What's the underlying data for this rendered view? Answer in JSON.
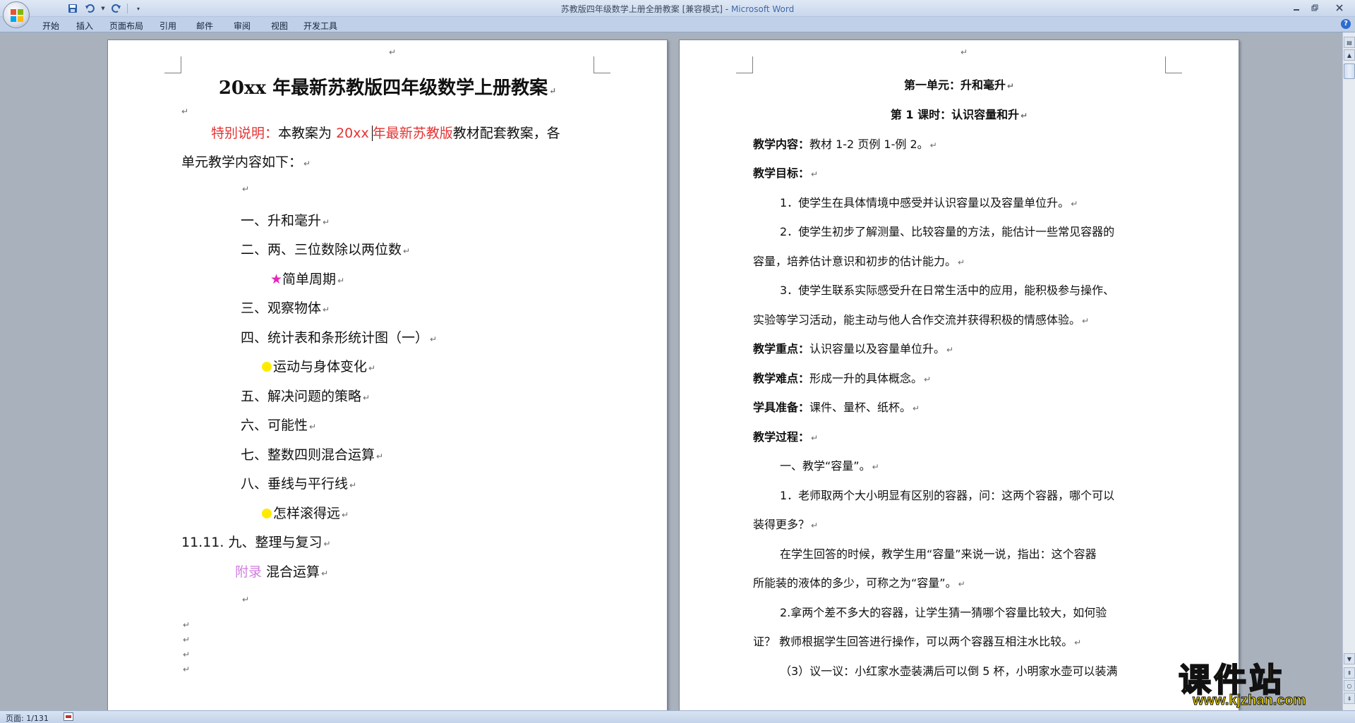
{
  "window": {
    "title": "苏教版四年级数学上册全册教案 [兼容模式]",
    "app_name": "Microsoft Word",
    "title_sep": " - "
  },
  "qat": {
    "save_icon": "save-icon",
    "undo_icon": "undo-icon",
    "redo_icon": "redo-icon",
    "customize_icon": "dropdown-icon"
  },
  "ribbon": {
    "tabs": [
      "开始",
      "插入",
      "页面布局",
      "引用",
      "邮件",
      "审阅",
      "视图",
      "开发工具"
    ]
  },
  "left_page": {
    "title": "20xx 年最新苏教版四年级数学上册教案",
    "intro_label": "特别说明：",
    "intro_text1": "本教案为 ",
    "intro_year": "20xx ",
    "intro_red": "年最新苏教版",
    "intro_text2": "教材配套教案，各",
    "intro_line2": "单元教学内容如下：",
    "units": [
      "一、升和毫升",
      "二、两、三位数除以两位数",
      "简单周期",
      "三、观察物体",
      "四、统计表和条形统计图（一）",
      "运动与身体变化",
      "五、解决问题的策略",
      "六、可能性",
      "七、整数四则混合运算",
      "八、垂线与平行线",
      "怎样滚得远",
      "11.11. 九、整理与复习"
    ],
    "appendix_label": "附录",
    "appendix_text": " 混合运算",
    "star_symbol": "★",
    "para_mark": "↵"
  },
  "right_page": {
    "unit_title": "第一单元：升和毫升",
    "lesson_title": "第 1 课时：认识容量和升",
    "content_label": "教学内容：",
    "content_text": "教材 1-2 页例 1-例 2。",
    "goals_label": "教学目标：",
    "goal1": "1．使学生在具体情境中感受并认识容量以及容量单位升。",
    "goal2a": "2．使学生初步了解测量、比较容量的方法，能估计一些常见容器的",
    "goal2b": "容量，培养估计意识和初步的估计能力。",
    "goal3a": "3．使学生联系实际感受升在日常生活中的应用，能积极参与操作、",
    "goal3b": "实验等学习活动，能主动与他人合作交流并获得积极的情感体验。",
    "key_label": "教学重点：",
    "key_text": "认识容量以及容量单位升。",
    "diff_label": "教学难点：",
    "diff_text": "形成一升的具体概念。",
    "tools_label": "学具准备：",
    "tools_text": "课件、量杯、纸杯。",
    "process_label": "教学过程：",
    "p1": "一、教学“容量”。",
    "p2a": "1．老师取两个大小明显有区别的容器，问：这两个容器，哪个可以",
    "p2b": "装得更多？",
    "p3a": "在学生回答的时候，教学生用“容量”来说一说，指出：这个容器",
    "p3b": "所能装的液体的多少，可称之为“容量”。",
    "p4a": "2.拿两个差不多大的容器，让学生猜一猜哪个容量比较大，如何验",
    "p4b": "证？ 教师根据学生回答进行操作，可以两个容器互相注水比较。",
    "p5": "（3）议一议：小红家水壶装满后可以倒 5 杯，小明家水壶可以装满"
  },
  "statusbar": {
    "page": "页面: 1/131"
  },
  "watermark": {
    "text": "课件站",
    "url": "www.kjzhan.com"
  },
  "colors": {
    "red": "#e53333",
    "pink": "#d27be0",
    "star": "#e625b8",
    "yellow_dot": "#ffeb00",
    "watermark": "#f2d900"
  }
}
